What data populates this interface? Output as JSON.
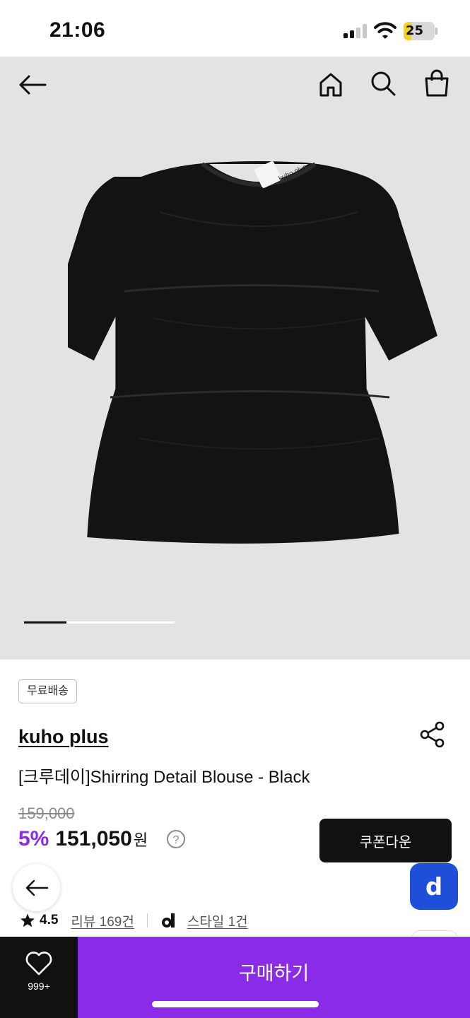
{
  "status_bar": {
    "time": "21:06",
    "battery_level": "25",
    "battery_percent": 25,
    "battery_color": "#f4d21f"
  },
  "top_nav": {
    "icons": [
      "back-arrow-icon",
      "home-icon",
      "search-icon",
      "shopping-bag-icon"
    ]
  },
  "hero": {
    "image_label": "kuho plus",
    "carousel_progress_fraction": 0.28,
    "background_color": "#e3e3e3"
  },
  "product": {
    "badge": "무료배송",
    "brand": "kuho plus",
    "title": "[크루데이]Shirring Detail Blouse - Black",
    "original_price": "159,000",
    "discount": "5%",
    "price": "151,050",
    "currency": "원",
    "help_symbol": "?",
    "coupon_button": "쿠폰다운",
    "rating": "4.5",
    "review_link": "리뷰 169건",
    "style_link": "스타일 1건",
    "floating_app_letter": "d"
  },
  "bottom_bar": {
    "wish_count": "999+",
    "buy_label": "구매하기",
    "accent_color": "#8a2be8"
  }
}
